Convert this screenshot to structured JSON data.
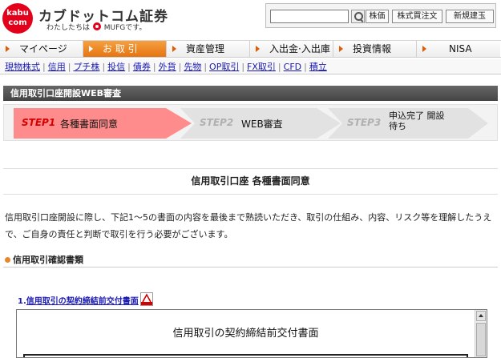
{
  "header": {
    "logo_text": "kabu com",
    "brand_name": "カブドットコム証券",
    "tagline_prefix": "わたしたちは",
    "tagline_suffix": "MUFGです。",
    "search_value": "",
    "quote_button": "株価",
    "order_button": "株式買注文",
    "new_button": "新規建玉",
    "accent_color": "#e4001b"
  },
  "main_nav": [
    {
      "label": "マイページ"
    },
    {
      "label": "お 取 引",
      "active": true
    },
    {
      "label": "資産管理"
    },
    {
      "label": "入出金·入出庫"
    },
    {
      "label": "投資情報"
    },
    {
      "label": "NISA"
    }
  ],
  "sub_nav": [
    "現物株式",
    "信用",
    "プチ株",
    "投信",
    "債券",
    "外貨",
    "先物",
    "OP取引",
    "FX取引",
    "CFD",
    "積立"
  ],
  "section_title": "信用取引口座開設WEB審査",
  "steps": [
    {
      "num": "STEP1",
      "label": "各種書面同意",
      "state": "current"
    },
    {
      "num": "STEP2",
      "label": "WEB審査",
      "state": "upcoming"
    },
    {
      "num": "STEP3",
      "label": "申込完了 開設待ち",
      "state": "upcoming"
    }
  ],
  "doc_title": "信用取引口座 各種書面同意",
  "intro_text": "信用取引口座開設に際し、下記1～5の書面の内容を最後まで熟読いただき、取引の仕組み、内容、リスク等を理解したうえで、ご自身の責任と判断で取引を行う必要がございます。",
  "confirm_heading": "信用取引確認書類",
  "documents": [
    {
      "num": "1.",
      "label": "信用取引の契約締結前交付書面",
      "icon": "pdf-icon"
    }
  ],
  "frame_title": "信用取引の契約締結前交付書面"
}
